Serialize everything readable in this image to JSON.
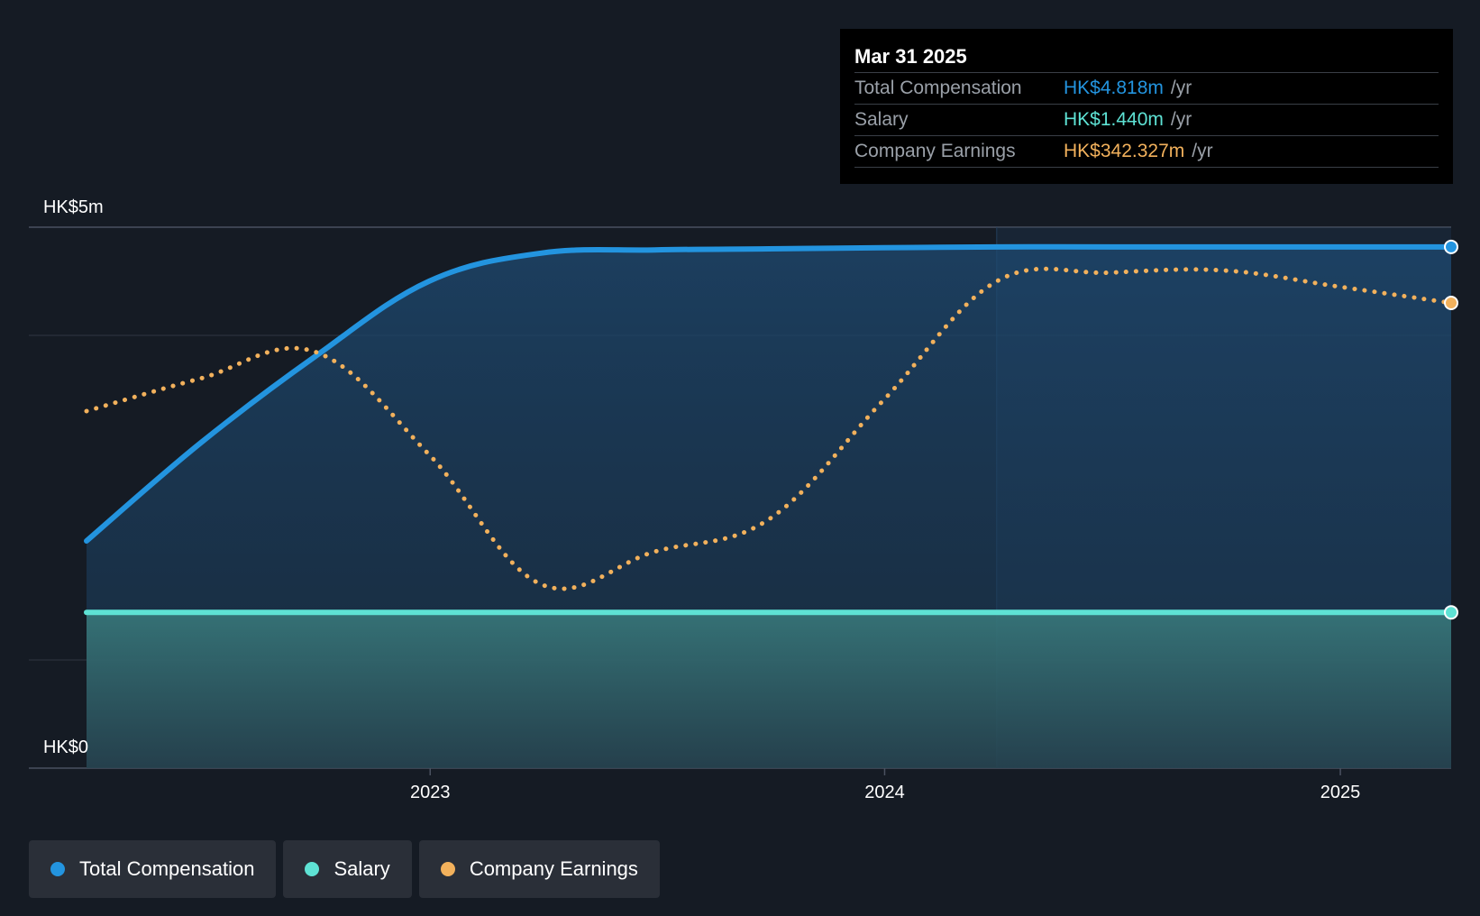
{
  "chart_data": {
    "type": "line",
    "y_labels": {
      "top": "HK$5m",
      "bottom": "HK$0"
    },
    "ylim": [
      0,
      5
    ],
    "x_ticks": [
      "2023",
      "2024",
      "2025"
    ],
    "series": [
      {
        "name": "Total Compensation",
        "color": "#2394df",
        "points": [
          [
            "2022-03-31",
            2.1
          ],
          [
            "2022-06-30",
            3.0
          ],
          [
            "2022-09-30",
            3.8
          ],
          [
            "2022-12-31",
            4.5
          ],
          [
            "2023-03-31",
            4.76
          ],
          [
            "2023-06-30",
            4.79
          ],
          [
            "2023-09-30",
            4.8
          ],
          [
            "2023-12-31",
            4.81
          ],
          [
            "2024-03-31",
            4.818
          ],
          [
            "2024-06-30",
            4.818
          ],
          [
            "2024-09-30",
            4.818
          ],
          [
            "2024-12-31",
            4.818
          ],
          [
            "2025-03-31",
            4.818
          ]
        ]
      },
      {
        "name": "Salary",
        "color": "#5ee2d4",
        "points": [
          [
            "2022-03-31",
            1.44
          ],
          [
            "2025-03-31",
            1.44
          ]
        ]
      },
      {
        "name": "Company Earnings",
        "color": "#f2b15c",
        "dashed": true,
        "points": [
          [
            "2022-03-31",
            3.3
          ],
          [
            "2022-06-30",
            3.6
          ],
          [
            "2022-09-30",
            3.85
          ],
          [
            "2022-12-31",
            2.9
          ],
          [
            "2023-03-31",
            1.7
          ],
          [
            "2023-06-30",
            2.0
          ],
          [
            "2023-09-30",
            2.3
          ],
          [
            "2023-12-31",
            3.4
          ],
          [
            "2024-03-31",
            4.5
          ],
          [
            "2024-06-30",
            4.58
          ],
          [
            "2024-09-30",
            4.6
          ],
          [
            "2024-12-31",
            4.45
          ],
          [
            "2025-03-31",
            4.3
          ]
        ]
      }
    ],
    "legend_placement": "bottom-left",
    "grid": true
  },
  "tooltip": {
    "date": "Mar 31 2025",
    "rows": [
      {
        "label": "Total Compensation",
        "value": "HK$4.818m",
        "unit": "/yr",
        "color": "#2394df"
      },
      {
        "label": "Salary",
        "value": "HK$1.440m",
        "unit": "/yr",
        "color": "#5ee2d4"
      },
      {
        "label": "Company Earnings",
        "value": "HK$342.327m",
        "unit": "/yr",
        "color": "#f2b15c"
      }
    ]
  },
  "legend": {
    "items": [
      {
        "label": "Total Compensation",
        "color": "#2394df"
      },
      {
        "label": "Salary",
        "color": "#5ee2d4"
      },
      {
        "label": "Company Earnings",
        "color": "#f2b15c"
      }
    ]
  }
}
